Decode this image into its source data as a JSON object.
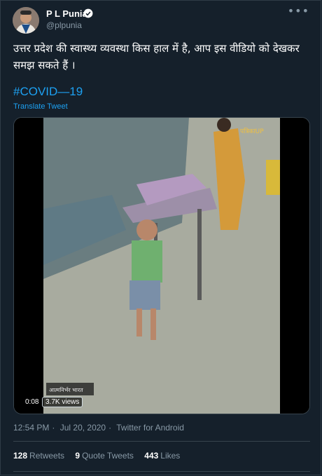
{
  "author": {
    "name": "P L Punia",
    "handle": "@plpunia"
  },
  "tweet": {
    "text": "उत्तर प्रदेश की स्वास्थ्य व्यवस्था किस हाल में है, आप इस वीडियो को देखकर समझ सकते हैं ।",
    "hashtag": "#COVID—19",
    "translate_label": "Translate Tweet"
  },
  "video": {
    "duration": "0:08",
    "views": "3.7K views",
    "watermark_bottom": "आत्मनिर्भर भारत",
    "watermark_top": "पत्रिकाUP"
  },
  "meta": {
    "time": "12:54 PM",
    "date": "Jul 20, 2020",
    "source": "Twitter for Android"
  },
  "stats": {
    "retweets_count": "128",
    "retweets_label": "Retweets",
    "quotes_count": "9",
    "quotes_label": "Quote Tweets",
    "likes_count": "443",
    "likes_label": "Likes"
  },
  "colors": {
    "background": "#15202b",
    "link": "#1da1f2",
    "muted": "#8899a6",
    "border": "#38444d"
  }
}
